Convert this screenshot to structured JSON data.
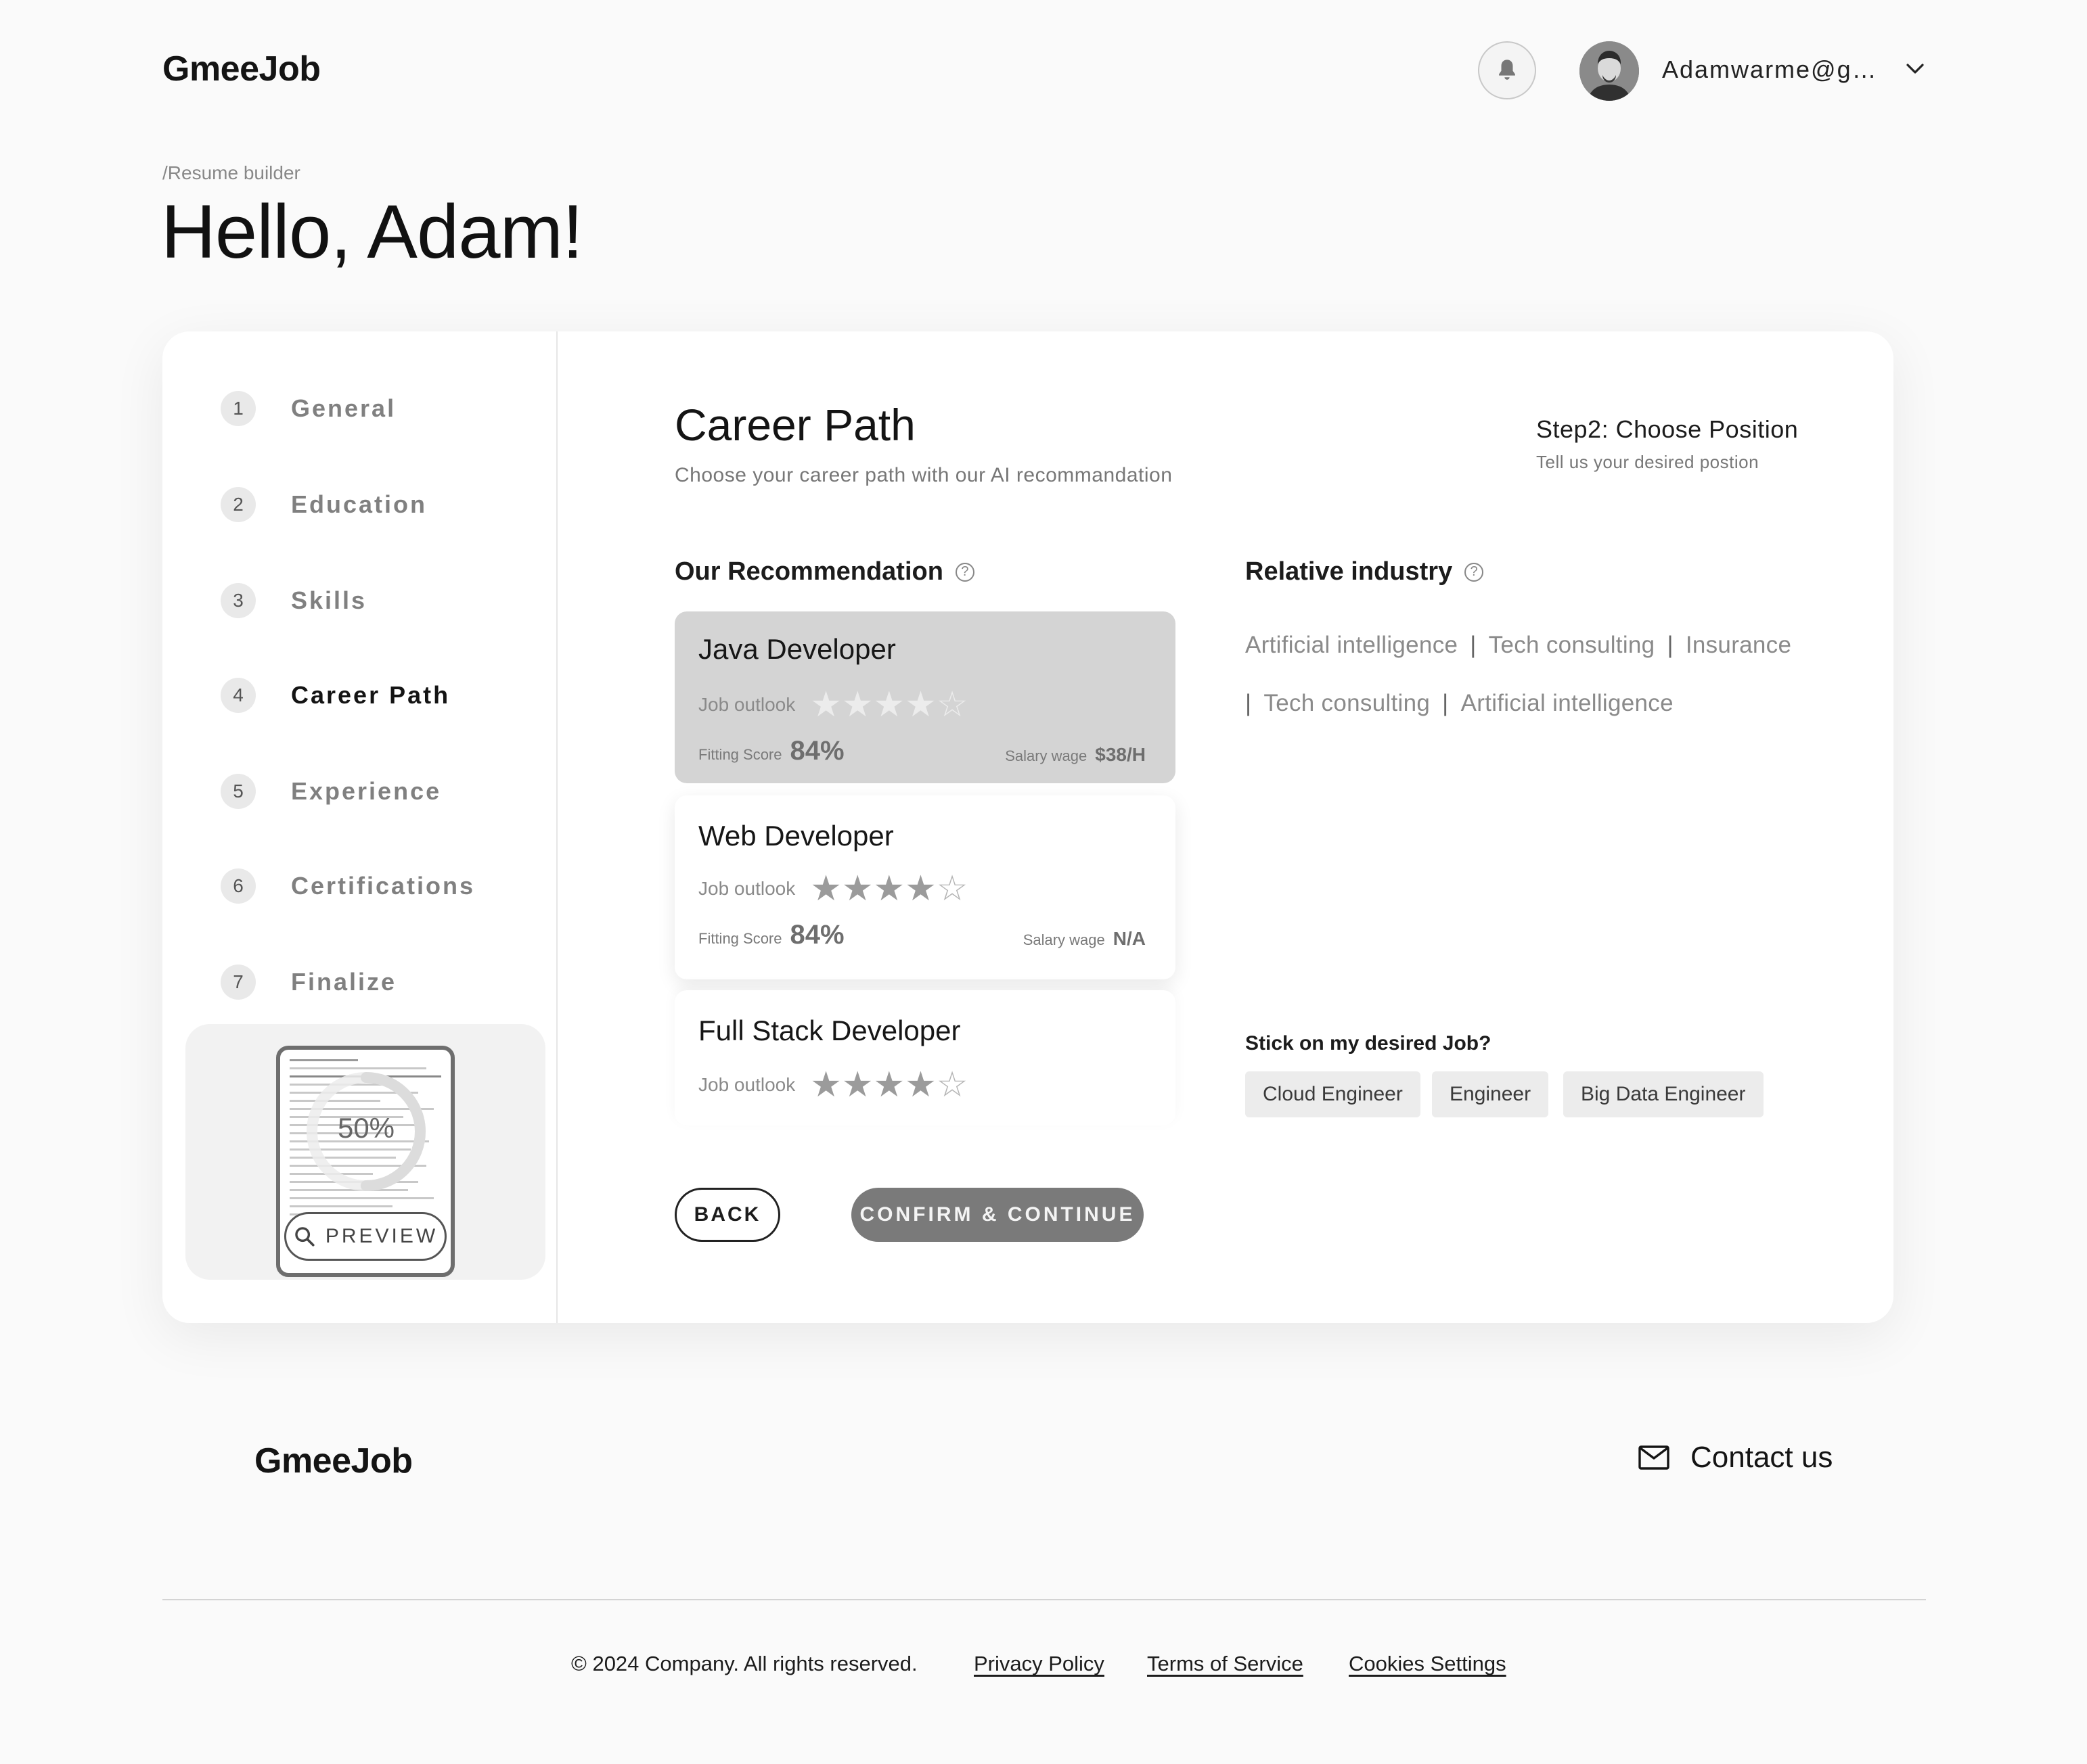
{
  "header": {
    "logo": "GmeeJob",
    "user_email": "Adamwarme@gm…",
    "icons": {
      "notifications": "bell-icon",
      "menu": "chevron-down-icon"
    }
  },
  "page": {
    "breadcrumb": "/Resume builder",
    "greeting": "Hello, Adam!"
  },
  "sidebar": {
    "steps": [
      {
        "num": "1",
        "label": "General"
      },
      {
        "num": "2",
        "label": "Education"
      },
      {
        "num": "3",
        "label": "Skills"
      },
      {
        "num": "4",
        "label": "Career Path",
        "active": true
      },
      {
        "num": "5",
        "label": "Experience"
      },
      {
        "num": "6",
        "label": "Certifications"
      },
      {
        "num": "7",
        "label": "Finalize"
      }
    ],
    "progress": "50%",
    "preview_label": "PREVIEW"
  },
  "main": {
    "title": "Career Path",
    "subtitle": "Choose your career path with our AI recommandation",
    "step_title": "Step2: Choose Position",
    "step_subtitle": "Tell us your desired postion",
    "recommendation_heading": "Our Recommendation",
    "industry_heading": "Relative industry",
    "jobs": [
      {
        "title": "Java Developer",
        "outlook_label": "Job outlook",
        "stars": 4,
        "fit_label": "Fitting Score",
        "fit": "84%",
        "salary_label": "Salary wage",
        "salary": "$38/H",
        "selected": true
      },
      {
        "title": "Web Developer",
        "outlook_label": "Job outlook",
        "stars": 4,
        "fit_label": "Fitting Score",
        "fit": "84%",
        "salary_label": "Salary wage",
        "salary": "N/A"
      },
      {
        "title": "Full Stack Developer",
        "outlook_label": "Job outlook",
        "stars": 4
      }
    ],
    "industries_line1": [
      "Artificial intelligence",
      "Tech consulting",
      "Insurance"
    ],
    "industries_line2": [
      "Tech consulting",
      "Artificial intelligence"
    ],
    "stick_heading": "Stick on my desired Job?",
    "desired_jobs": [
      "Cloud Engineer",
      "Engineer",
      "Big Data Engineer"
    ],
    "back_label": "BACK",
    "confirm_label": "CONFIRM & CONTINUE"
  },
  "footer": {
    "logo": "GmeeJob",
    "contact_label": "Contact us",
    "copyright": "© 2024 Company. All rights reserved.",
    "links": [
      "Privacy Policy",
      "Terms of Service",
      "Cookies Settings"
    ]
  },
  "colors": {
    "accent": "#7a7a7a",
    "selected_card": "#d4d4d4",
    "background": "#fafafa"
  }
}
